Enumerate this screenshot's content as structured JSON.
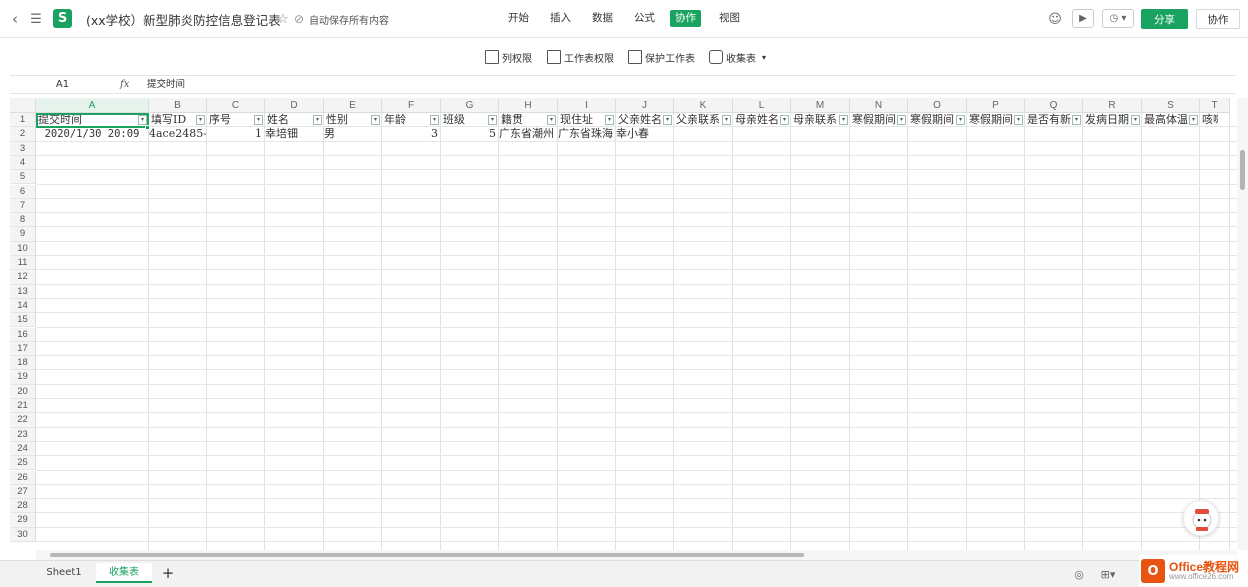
{
  "header": {
    "title": "(xx学校）新型肺炎防控信息登记表",
    "save_status": "自动保存所有内容",
    "menus": [
      "开始",
      "插入",
      "数据",
      "公式",
      "协作",
      "视图"
    ],
    "active_menu": "协作",
    "share_label": "分享",
    "collab_label": "协作"
  },
  "toolbar": {
    "col_perm": "列权限",
    "sheet_perm": "工作表权限",
    "protect_sheet": "保护工作表",
    "collect_table": "收集表"
  },
  "formula_bar": {
    "cell_ref": "A1",
    "fx_label": "fx",
    "value": "提交时间"
  },
  "grid": {
    "columns": [
      "A",
      "B",
      "C",
      "D",
      "E",
      "F",
      "G",
      "H",
      "I",
      "J",
      "K",
      "L",
      "M",
      "N",
      "O",
      "P",
      "Q",
      "R",
      "S",
      "T"
    ],
    "rows": [
      "1",
      "2",
      "3",
      "4",
      "5",
      "6",
      "7",
      "8",
      "9",
      "10",
      "11",
      "12",
      "13",
      "14",
      "15",
      "16",
      "17",
      "18",
      "19",
      "20",
      "21",
      "22",
      "23",
      "24",
      "25",
      "26",
      "27",
      "28",
      "29",
      "30"
    ],
    "header_row": [
      "提交时间",
      "填写ID",
      "序号",
      "姓名",
      "性别",
      "年龄",
      "班级",
      "籍贯",
      "现住址",
      "父亲姓名",
      "父亲联系",
      "母亲姓名",
      "母亲联系",
      "寒假期间",
      "寒假期间",
      "寒假期间",
      "是否有新",
      "发病日期",
      "最高体温",
      "咳嗽"
    ],
    "data_row": [
      "2020/1/30 20:09",
      "4ace2485-",
      "1",
      "幸培钿",
      "男",
      "3",
      "5",
      "广东省潮州",
      "广东省珠海",
      "幸小春",
      "",
      "",
      "",
      "",
      "",
      "",
      "",
      "",
      "",
      ""
    ]
  },
  "sheets": {
    "tabs": [
      "Sheet1",
      "收集表"
    ],
    "active": "收集表"
  },
  "watermark": {
    "name": "Office教程网",
    "url": "www.office26.com"
  },
  "colors": {
    "accent": "#1aa260",
    "brand_orange": "#e8530f"
  }
}
